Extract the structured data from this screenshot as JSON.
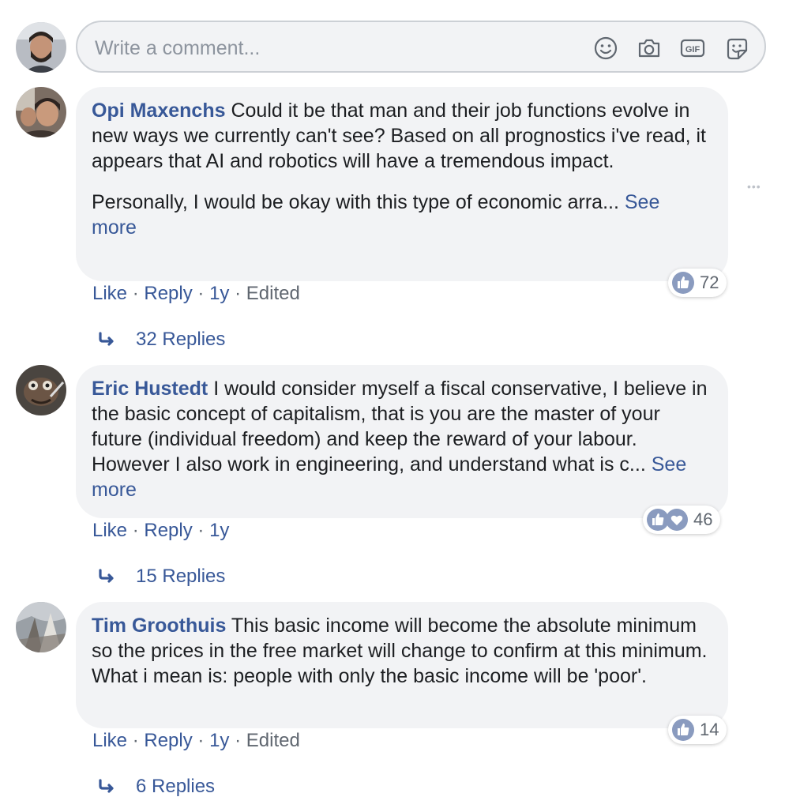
{
  "composer": {
    "placeholder": "Write a comment...",
    "icons": [
      "emoji-icon",
      "camera-icon",
      "gif-icon",
      "sticker-icon"
    ]
  },
  "comments": [
    {
      "author": "Opi Maxenchs",
      "paragraphs": [
        "Could it be that man and their job functions evolve in new ways we currently can't see? Based on all prognostics i've read, it appears that AI and robotics will have a tremendous impact.",
        "Personally, I would be okay with this type of economic arra..."
      ],
      "see_more": "See more",
      "actions": {
        "like": "Like",
        "reply": "Reply",
        "time": "1y",
        "edited": "Edited"
      },
      "reactions": {
        "icons": [
          "like"
        ],
        "count": "72"
      },
      "replies": "32 Replies"
    },
    {
      "author": "Eric Hustedt",
      "paragraphs": [
        "I would consider myself a fiscal conservative, I believe in the basic concept of capitalism, that is you are the master of your future (individual freedom) and keep the reward of your labour. However I also work in engineering, and understand what is c..."
      ],
      "see_more": "See more",
      "actions": {
        "like": "Like",
        "reply": "Reply",
        "time": "1y"
      },
      "reactions": {
        "icons": [
          "like",
          "love"
        ],
        "count": "46"
      },
      "replies": "15 Replies"
    },
    {
      "author": "Tim Groothuis",
      "paragraphs": [
        "This basic income will become the absolute minimum so the prices in the free market will change to confirm at this minimum. What i mean is: people with only the basic income will be 'poor'."
      ],
      "actions": {
        "like": "Like",
        "reply": "Reply",
        "time": "1y",
        "edited": "Edited"
      },
      "reactions": {
        "icons": [
          "like"
        ],
        "count": "14"
      },
      "replies": "6 Replies"
    }
  ],
  "more_options": "•••",
  "colors": {
    "link": "#385898",
    "bubble": "#f2f3f5",
    "meta": "#606770",
    "like_badge": "#8a9bbf"
  }
}
